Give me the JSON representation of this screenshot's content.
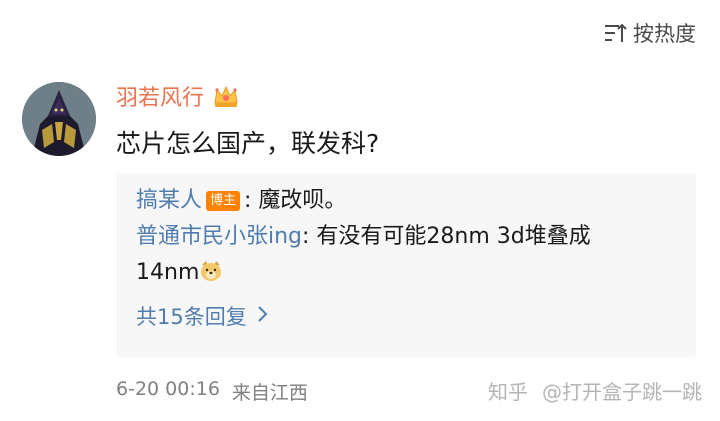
{
  "sort": {
    "label": "按热度",
    "icon": "sort-icon"
  },
  "comment": {
    "username": "羽若风行",
    "text": "芯片怎么国产，联发科?",
    "time": "6-20 00:16",
    "location": "来自江西"
  },
  "replies": [
    {
      "name": "搞某人",
      "badge": "博主",
      "text": ": 魔改呗。"
    },
    {
      "name": "普通市民小张ing",
      "text": ": 有没有可能28nm 3d堆叠成",
      "text2": "14nm"
    }
  ],
  "more_replies": {
    "label": "共15条回复",
    "icon": "chevron-right-icon"
  },
  "watermark": {
    "site": "知乎",
    "author": "@打开盒子跳一跳"
  },
  "colors": {
    "username": "#eb7350",
    "link": "#507daf",
    "badge": "#ff8200",
    "reply_bg": "#f7f7f7"
  }
}
